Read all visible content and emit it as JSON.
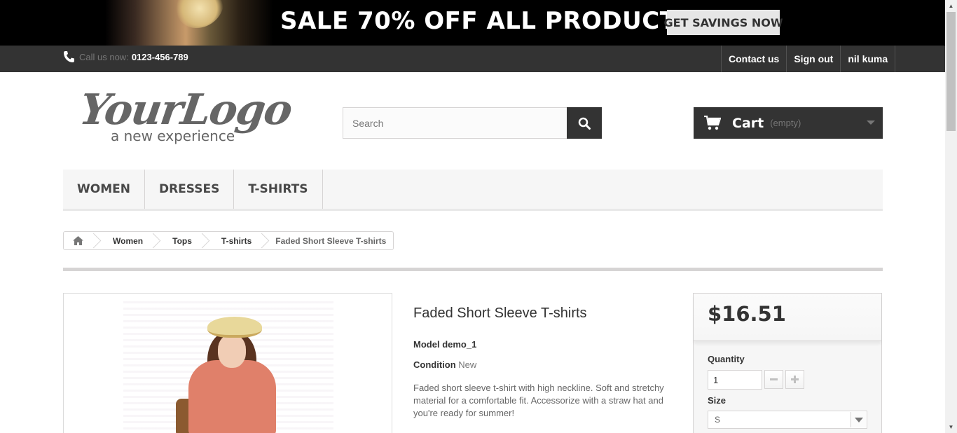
{
  "banner": {
    "title": "SALE 70% OFF ALL PRODUCTS",
    "button_label": "GET SAVINGS NOW"
  },
  "topnav": {
    "call_label": "Call us now:",
    "phone_number": "0123-456-789",
    "links": [
      "Contact us",
      "Sign out",
      "nil kuma"
    ]
  },
  "logo": {
    "main": "YourLogo",
    "tagline": "a new experience"
  },
  "search": {
    "placeholder": "Search",
    "value": ""
  },
  "cart": {
    "label": "Cart",
    "status": "(empty)"
  },
  "menu": {
    "items": [
      "WOMEN",
      "DRESSES",
      "T-SHIRTS"
    ]
  },
  "breadcrumb": {
    "items": [
      "Women",
      "Tops",
      "T-shirts"
    ],
    "current": "Faded Short Sleeve T-shirts"
  },
  "product": {
    "name": "Faded Short Sleeve T-shirts",
    "model_label": "Model",
    "model_value": "demo_1",
    "condition_label": "Condition",
    "condition_value": "New",
    "description": "Faded short sleeve t-shirt with high neckline. Soft and stretchy material for a comfortable fit. Accessorize with a straw hat and you're ready for summer!"
  },
  "buybox": {
    "price": "$16.51",
    "quantity_label": "Quantity",
    "quantity_value": "1",
    "size_label": "Size",
    "size_value": "S"
  },
  "icons": {
    "phone": "phone-icon",
    "search": "search-icon",
    "cart": "cart-icon",
    "home": "home-icon",
    "minus": "minus-icon",
    "plus": "plus-icon"
  },
  "colors": {
    "dark_bar": "#333333",
    "banner_bg": "#000000",
    "menu_bg": "#f6f6f6",
    "border": "#d6d4d4"
  }
}
